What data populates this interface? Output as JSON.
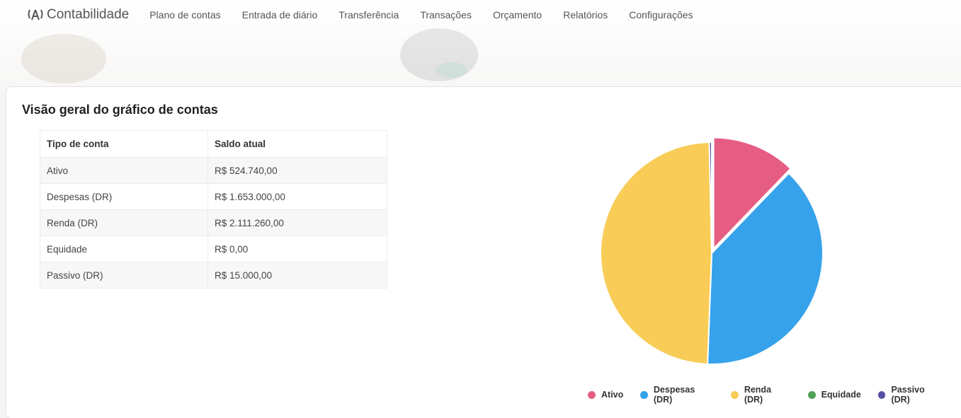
{
  "nav": {
    "brand": "Contabilidade",
    "items": [
      "Plano de contas",
      "Entrada de diário",
      "Transferência",
      "Transações",
      "Orçamento",
      "Relatórios",
      "Configurações"
    ]
  },
  "card": {
    "title": "Visão geral do gráfico de contas"
  },
  "table": {
    "headers": [
      "Tipo de conta",
      "Saldo atual"
    ],
    "rows": [
      [
        "Ativo",
        "R$ 524.740,00"
      ],
      [
        "Despesas (DR)",
        "R$ 1.653.000,00"
      ],
      [
        "Renda (DR)",
        "R$ 2.111.260,00"
      ],
      [
        "Equidade",
        "R$ 0,00"
      ],
      [
        "Passivo (DR)",
        "R$ 15.000,00"
      ]
    ]
  },
  "chart_data": {
    "type": "pie",
    "categories": [
      "Ativo",
      "Despesas (DR)",
      "Renda (DR)",
      "Equidade",
      "Passivo (DR)"
    ],
    "values": [
      524740,
      1653000,
      2111260,
      0,
      15000
    ],
    "colors": [
      "#e65d83",
      "#36a2eb",
      "#f8cc56",
      "#4ea257",
      "#5650a5"
    ],
    "selected": "Ativo",
    "legend_position": "bottom"
  }
}
